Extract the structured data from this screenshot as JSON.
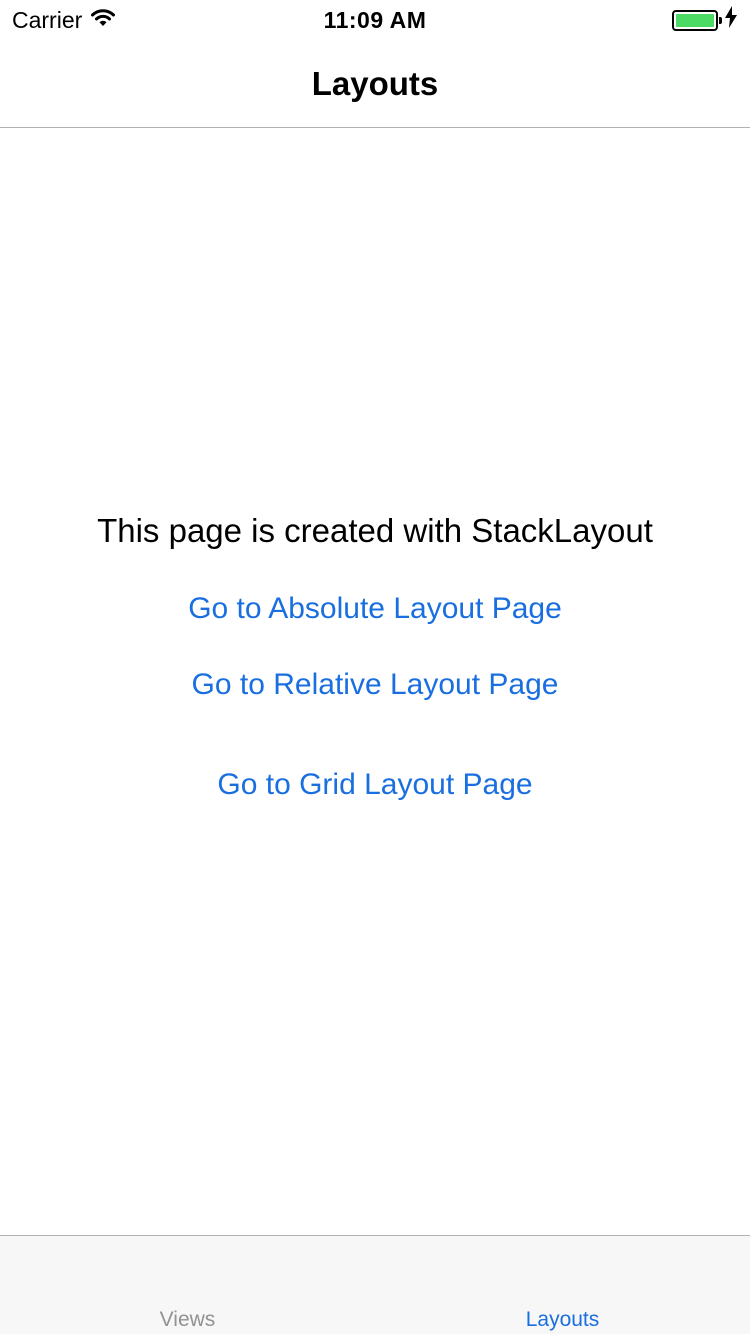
{
  "status_bar": {
    "carrier": "Carrier",
    "time": "11:09 AM",
    "battery_color": "#4cd964"
  },
  "nav": {
    "title": "Layouts"
  },
  "content": {
    "label": "This page is created with StackLayout",
    "buttons": [
      "Go to Absolute Layout Page",
      "Go to Relative Layout Page",
      "Go to Grid Layout Page"
    ],
    "link_color": "#1a6fe0"
  },
  "tab_bar": {
    "tabs": [
      "Views",
      "Layouts"
    ],
    "active_tab": "Layouts"
  }
}
